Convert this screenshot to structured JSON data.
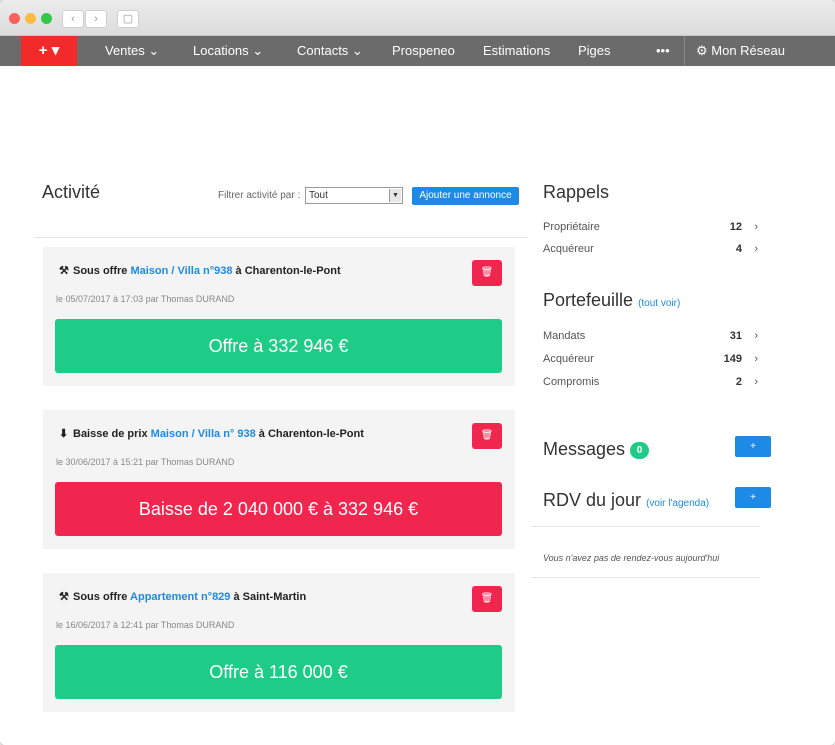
{
  "browser": {
    "back_glyph": "‹",
    "forward_glyph": "›",
    "sidebar_glyph": "▢"
  },
  "nav": {
    "plus_label": "+ ▾",
    "items": [
      {
        "label": "Ventes ⌄"
      },
      {
        "label": "Locations ⌄"
      },
      {
        "label": "Contacts ⌄"
      },
      {
        "label": "Prospeneo"
      },
      {
        "label": "Estimations"
      },
      {
        "label": "Piges"
      },
      {
        "label": "•••"
      },
      {
        "label": "⚙ Mon Réseau"
      }
    ]
  },
  "activity": {
    "title": "Activité",
    "filter_label": "Filtrer activité par :",
    "filter_value": "Tout",
    "add_button": "Ajouter une annonce",
    "cards": [
      {
        "icon": "⚒",
        "prefix": "Sous offre ",
        "link": "Maison / Villa n°938",
        "suffix": " à Charenton-le-Pont",
        "date": "le 05/07/2017 à 17:03 par Thomas DURAND",
        "banner": "Offre à 332 946 €",
        "banner_color": "#1ecc87"
      },
      {
        "icon": "⬇",
        "prefix": "Baisse de prix ",
        "link": "Maison / Villa n° 938",
        "suffix": " à Charenton-le-Pont",
        "date": "le 30/06/2017 à 15:21 par Thomas DURAND",
        "banner": "Baisse de 2 040 000 € à 332 946 €",
        "banner_color": "#f0264f"
      },
      {
        "icon": "⚒",
        "prefix": "Sous offre ",
        "link": "Appartement n°829",
        "suffix": " à Saint-Martin",
        "date": "le 16/06/2017 à 12:41 par Thomas DURAND",
        "banner": "Offre à 116 000 €",
        "banner_color": "#1ecc87"
      }
    ],
    "delete_icon": "🗑"
  },
  "rappels": {
    "title": "Rappels",
    "rows": [
      {
        "label": "Propriétaire",
        "count": "12"
      },
      {
        "label": "Acquéreur",
        "count": "4"
      }
    ]
  },
  "portefeuille": {
    "title": "Portefeuille",
    "link": "(tout voir)",
    "rows": [
      {
        "label": "Mandats",
        "count": "31"
      },
      {
        "label": "Acquéreur",
        "count": "149"
      },
      {
        "label": "Compromis",
        "count": "2"
      }
    ]
  },
  "messages": {
    "title": "Messages",
    "badge": "0",
    "add_label": "+"
  },
  "rdv": {
    "title": "RDV du jour",
    "link": "(voir l'agenda)",
    "add_label": "+",
    "empty_text": "Vous n'avez pas de rendez-vous aujourd'hui"
  },
  "chevron": "›",
  "colors": {
    "accent_blue": "#1d8ae6",
    "green": "#1ecc87",
    "red": "#f0264f",
    "nav_bg": "#6b6b6b",
    "nav_plus": "#f22a2a"
  }
}
